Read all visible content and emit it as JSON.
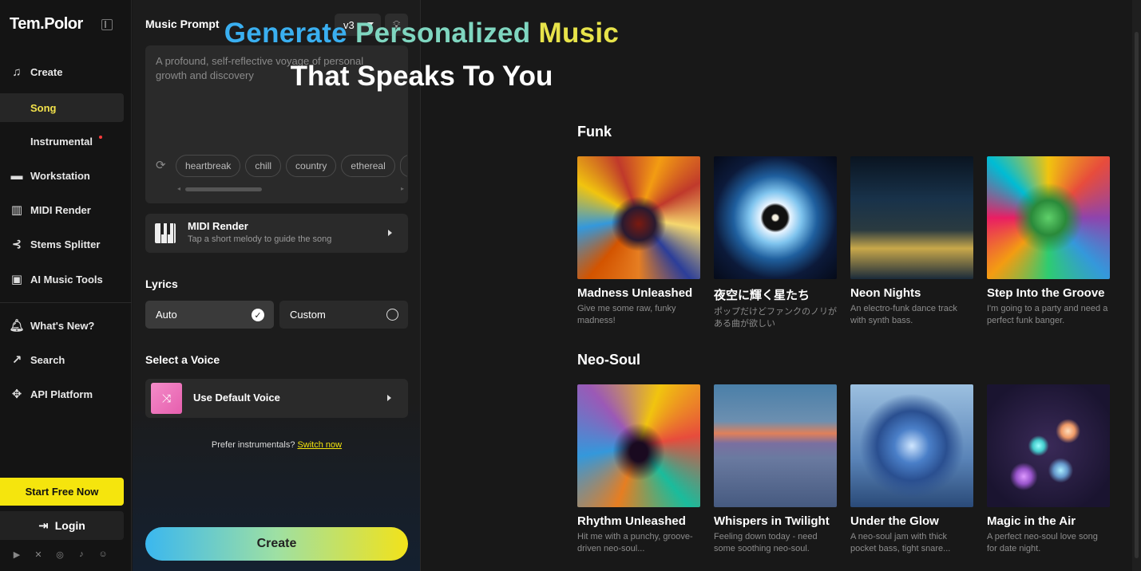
{
  "sidebar": {
    "logo": "Tem.Polor",
    "nav": {
      "create": "Create",
      "song": "Song",
      "instrumental": "Instrumental",
      "workstation": "Workstation",
      "midi_render": "MIDI Render",
      "stems_splitter": "Stems Splitter",
      "ai_music_tools": "AI Music Tools",
      "whats_new": "What's New?",
      "search": "Search",
      "api_platform": "API Platform"
    },
    "start_free": "Start Free Now",
    "login": "Login",
    "socials": [
      "youtube-icon",
      "x-icon",
      "instagram-icon",
      "tiktok-icon",
      "discord-icon"
    ]
  },
  "prompt": {
    "title": "Music Prompt",
    "version": "v3",
    "placeholder": "A profound, self-reflective voyage of personal growth and discovery",
    "tags": [
      "heartbreak",
      "chill",
      "country",
      "ethereal"
    ],
    "midi_title": "MIDI Render",
    "midi_sub": "Tap a short melody to guide the song",
    "lyrics_heading": "Lyrics",
    "lyrics_auto": "Auto",
    "lyrics_custom": "Custom",
    "voice_heading": "Select a Voice",
    "voice_label": "Use Default Voice",
    "prefer_text": "Prefer instrumentals?",
    "switch_link": "Switch now",
    "create_button": "Create"
  },
  "main": {
    "headline_1a": "Generate",
    "headline_1b": "Personalized",
    "headline_1c": "Music",
    "headline_2": "That Speaks To You",
    "sections": [
      {
        "name": "Funk",
        "cards": [
          {
            "title": "Madness Unleashed",
            "desc": "Give me some raw, funky madness!"
          },
          {
            "title": "夜空に輝く星たち",
            "desc": "ポップだけどファンクのノリがある曲が欲しい"
          },
          {
            "title": "Neon Nights",
            "desc": "An electro-funk dance track with synth bass."
          },
          {
            "title": "Step Into the Groove",
            "desc": "I'm going to a party and need a perfect funk banger."
          }
        ]
      },
      {
        "name": "Neo-Soul",
        "cards": [
          {
            "title": "Rhythm Unleashed",
            "desc": "Hit me with a punchy, groove-driven neo-soul..."
          },
          {
            "title": "Whispers in Twilight",
            "desc": "Feeling down today - need some soothing neo-soul."
          },
          {
            "title": "Under the Glow",
            "desc": "A neo-soul jam with thick pocket bass, tight snare..."
          },
          {
            "title": "Magic in the Air",
            "desc": "A perfect neo-soul love song for date night."
          }
        ]
      }
    ]
  },
  "colors": {
    "accent_yellow": "#f5e50d",
    "headline_blue": "#3aaff0",
    "headline_teal": "#7fd6c0",
    "headline_yellow": "#e7e34a"
  }
}
